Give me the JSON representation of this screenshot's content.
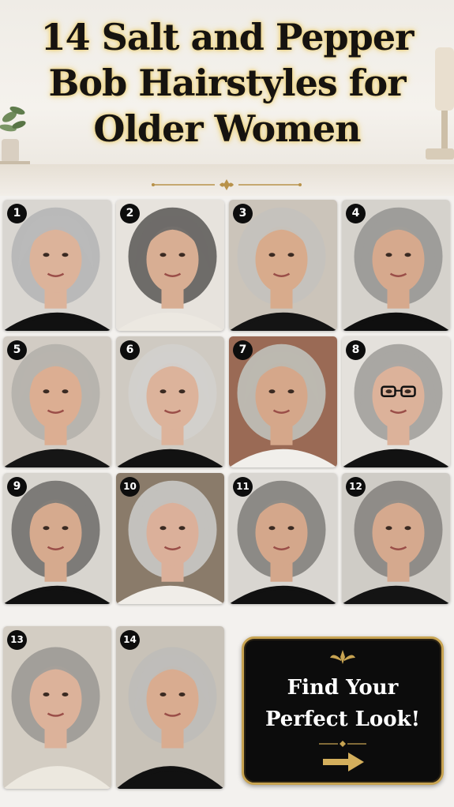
{
  "title_lines": [
    "14 Salt and Pepper",
    "Bob Hairstyles for",
    "Older Women"
  ],
  "colors": {
    "title_glow": "#e8c765",
    "gold": "#c8a452",
    "badge": "#0d0d0d"
  },
  "styles": [
    {
      "number": "1",
      "hair": "#b9b9b9",
      "skin": "#dcb39a",
      "top": "#111111",
      "bg": "#d9d6d1"
    },
    {
      "number": "2",
      "hair": "#6e6c69",
      "skin": "#d8ae93",
      "top": "#ece8e1",
      "bg": "#e7e3dd"
    },
    {
      "number": "3",
      "hair": "#c5c2bd",
      "skin": "#d8ab8c",
      "top": "#141414",
      "bg": "#cbc4ba"
    },
    {
      "number": "4",
      "hair": "#9e9d9a",
      "skin": "#d6a98d",
      "top": "#0f0f0f",
      "bg": "#d5d2cc"
    },
    {
      "number": "5",
      "hair": "#b7b4ae",
      "skin": "#dcae92",
      "top": "#161616",
      "bg": "#d2ccc4"
    },
    {
      "number": "6",
      "hair": "#d2d0cc",
      "skin": "#dcb39b",
      "top": "#121212",
      "bg": "#cfcac2"
    },
    {
      "number": "7",
      "hair": "#bcb8b0",
      "skin": "#d5a78a",
      "top": "#f1efeb",
      "bg": "#9a6a55"
    },
    {
      "number": "8",
      "hair": "#a9a7a3",
      "skin": "#dcb29a",
      "top": "#121212",
      "bg": "#e4e1dc"
    },
    {
      "number": "9",
      "hair": "#7d7b78",
      "skin": "#d6aa8e",
      "top": "#111111",
      "bg": "#d8d5cf"
    },
    {
      "number": "10",
      "hair": "#c3c1bd",
      "skin": "#dbb09a",
      "top": "#f0ede8",
      "bg": "#8a7b6a"
    },
    {
      "number": "11",
      "hair": "#8c8a86",
      "skin": "#d4a78b",
      "top": "#111111",
      "bg": "#d9d6d1"
    },
    {
      "number": "12",
      "hair": "#8f8c88",
      "skin": "#d5a98e",
      "top": "#141414",
      "bg": "#cfccc6"
    },
    {
      "number": "13",
      "hair": "#a29f9a",
      "skin": "#dcb29a",
      "top": "#ece8df",
      "bg": "#d3cdc3"
    },
    {
      "number": "14",
      "hair": "#bfbdb9",
      "skin": "#d9ac90",
      "top": "#111111",
      "bg": "#c8c2b8"
    }
  ],
  "cta": {
    "line1": "Find Your",
    "line2": "Perfect Look!",
    "arrow_icon": "arrow-right-icon",
    "ornament_icon": "fleur-ornament-icon"
  }
}
